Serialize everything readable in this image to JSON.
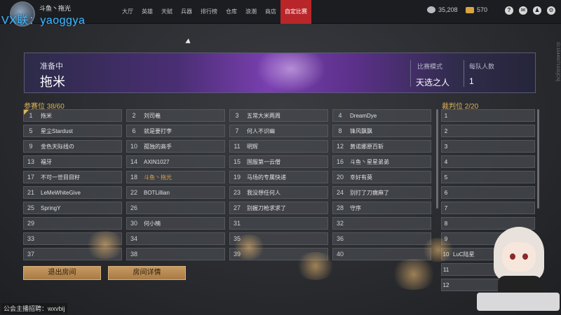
{
  "watermark": "VX联：yaoggya",
  "player": {
    "name": "斗鱼丶拖光",
    "sub": ""
  },
  "nav": {
    "items": [
      {
        "label": "大厅",
        "active": false,
        "badge": false
      },
      {
        "label": "英雄",
        "active": false,
        "badge": true
      },
      {
        "label": "天赋",
        "active": false,
        "badge": true
      },
      {
        "label": "兵器",
        "active": false,
        "badge": false
      },
      {
        "label": "排行榜",
        "active": false,
        "badge": false
      },
      {
        "label": "仓库",
        "active": false,
        "badge": false
      },
      {
        "label": "浪潮",
        "active": false,
        "badge": false
      },
      {
        "label": "商店",
        "active": false,
        "badge": false
      },
      {
        "label": "自定比赛",
        "active": true,
        "badge": false
      }
    ]
  },
  "currency": {
    "silver": "35,208",
    "gold": "570"
  },
  "top_icons": [
    {
      "name": "help-icon",
      "glyph": "?"
    },
    {
      "name": "mail-icon",
      "glyph": "✉"
    },
    {
      "name": "friends-icon",
      "glyph": "♟"
    },
    {
      "name": "settings-icon",
      "glyph": "⚙"
    }
  ],
  "side_code": "ID:15440071631[CN]",
  "banner": {
    "status": "准备中",
    "room_name": "拖米",
    "mode_label": "比赛模式",
    "mode_value": "天选之人",
    "team_size_label": "每队人数",
    "team_size_value": "1"
  },
  "participants": {
    "label": "参赛位 38/60",
    "slots": [
      {
        "num": "1",
        "name": "拖米"
      },
      {
        "num": "2",
        "name": "刘司羲"
      },
      {
        "num": "3",
        "name": "五常大米两周"
      },
      {
        "num": "4",
        "name": "DreamDye"
      },
      {
        "num": "5",
        "name": "星尘Stardust"
      },
      {
        "num": "6",
        "name": "就是要打李"
      },
      {
        "num": "7",
        "name": "何人不识幽"
      },
      {
        "num": "8",
        "name": "锋风飘飘"
      },
      {
        "num": "9",
        "name": "金色天际线の"
      },
      {
        "num": "10",
        "name": "孤独的高手"
      },
      {
        "num": "11",
        "name": "明辉"
      },
      {
        "num": "12",
        "name": "黄诺娜原百斩"
      },
      {
        "num": "13",
        "name": "福牙"
      },
      {
        "num": "14",
        "name": "AXIN1027"
      },
      {
        "num": "15",
        "name": "国服第一云僧"
      },
      {
        "num": "16",
        "name": "斗鱼丶星星弟弟"
      },
      {
        "num": "17",
        "name": "不可一世目目籽"
      },
      {
        "num": "18",
        "name": "斗鱼丶拖光"
      },
      {
        "num": "19",
        "name": "马场的专属快递"
      },
      {
        "num": "20",
        "name": "幸好有莫"
      },
      {
        "num": "21",
        "name": "LeMeWhiteGive"
      },
      {
        "num": "22",
        "name": "BOTLillian"
      },
      {
        "num": "23",
        "name": "我没想任何人"
      },
      {
        "num": "24",
        "name": "别打了刀瘸麻了"
      },
      {
        "num": "25",
        "name": "SpringY"
      },
      {
        "num": "26",
        "name": ""
      },
      {
        "num": "27",
        "name": "别握刀枪求求了"
      },
      {
        "num": "28",
        "name": "守序"
      },
      {
        "num": "29",
        "name": ""
      },
      {
        "num": "30",
        "name": "何小楠"
      },
      {
        "num": "31",
        "name": ""
      },
      {
        "num": "32",
        "name": ""
      },
      {
        "num": "33",
        "name": ""
      },
      {
        "num": "34",
        "name": ""
      },
      {
        "num": "35",
        "name": ""
      },
      {
        "num": "36",
        "name": ""
      },
      {
        "num": "37",
        "name": ""
      },
      {
        "num": "38",
        "name": ""
      },
      {
        "num": "39",
        "name": ""
      },
      {
        "num": "40",
        "name": ""
      }
    ]
  },
  "referees": {
    "label": "裁判位 2/20",
    "slots": [
      {
        "num": "1",
        "name": ""
      },
      {
        "num": "2",
        "name": ""
      },
      {
        "num": "3",
        "name": ""
      },
      {
        "num": "4",
        "name": ""
      },
      {
        "num": "5",
        "name": ""
      },
      {
        "num": "6",
        "name": ""
      },
      {
        "num": "7",
        "name": ""
      },
      {
        "num": "8",
        "name": ""
      },
      {
        "num": "9",
        "name": ""
      },
      {
        "num": "10",
        "name": "LuC陆星"
      },
      {
        "num": "11",
        "name": ""
      },
      {
        "num": "12",
        "name": ""
      }
    ]
  },
  "buttons": {
    "leave": "退出房间",
    "details": "房间详情"
  },
  "footer": "公会主播招聘：wxvbij"
}
